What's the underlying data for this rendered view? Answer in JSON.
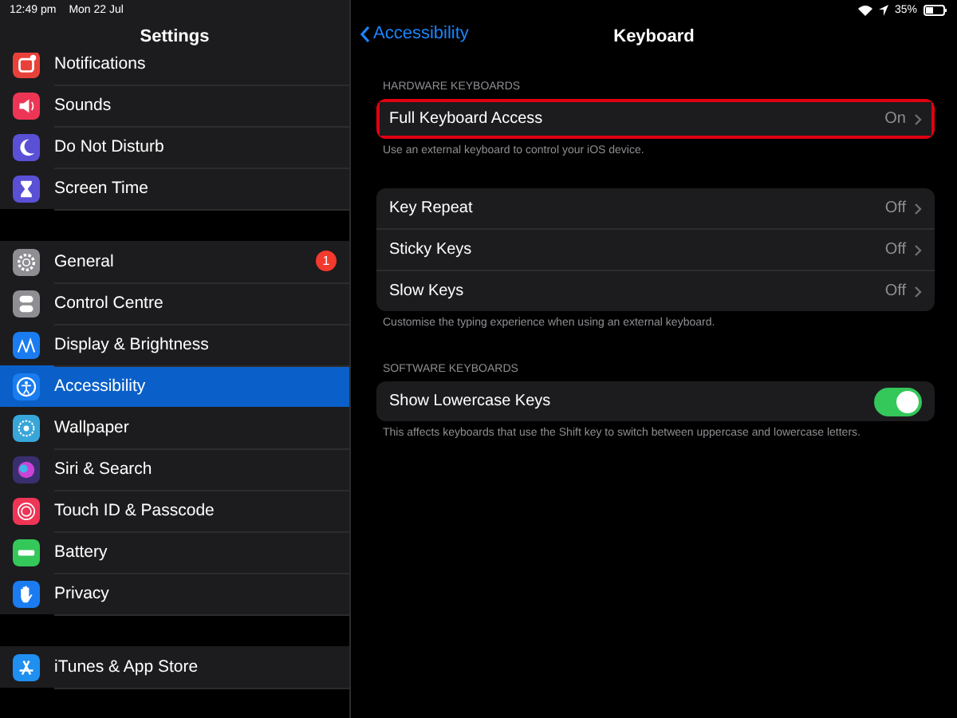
{
  "status_bar": {
    "time": "12:49 pm",
    "date": "Mon 22 Jul",
    "battery": "35%"
  },
  "sidebar": {
    "title": "Settings",
    "groups": [
      [
        {
          "label": "Notifications",
          "color": "#e8413a",
          "selected": false
        },
        {
          "label": "Sounds",
          "color": "#ee3556",
          "selected": false
        },
        {
          "label": "Do Not Disturb",
          "color": "#5a50d6",
          "selected": false
        },
        {
          "label": "Screen Time",
          "color": "#5a50d6",
          "selected": false
        }
      ],
      [
        {
          "label": "General",
          "color": "#8e8e93",
          "selected": false,
          "badge": "1"
        },
        {
          "label": "Control Centre",
          "color": "#8e8e93",
          "selected": false
        },
        {
          "label": "Display & Brightness",
          "color": "#1a7cf0",
          "selected": false
        },
        {
          "label": "Accessibility",
          "color": "#1a7cf0",
          "selected": true
        },
        {
          "label": "Wallpaper",
          "color": "#38a6d8",
          "selected": false
        },
        {
          "label": "Siri & Search",
          "color": "#3a2f6e",
          "selected": false
        },
        {
          "label": "Touch ID & Passcode",
          "color": "#ee3556",
          "selected": false
        },
        {
          "label": "Battery",
          "color": "#34c759",
          "selected": false
        },
        {
          "label": "Privacy",
          "color": "#1a7cf0",
          "selected": false
        }
      ],
      [
        {
          "label": "iTunes & App Store",
          "color": "#1f8ff0",
          "selected": false
        }
      ]
    ]
  },
  "detail": {
    "back": "Accessibility",
    "title": "Keyboard",
    "sections": [
      {
        "header": "HARDWARE KEYBOARDS",
        "rows": [
          {
            "kind": "link",
            "label": "Full Keyboard Access",
            "value": "On",
            "outlined": true
          }
        ],
        "footer": "Use an external keyboard to control your iOS device."
      },
      {
        "rows": [
          {
            "kind": "link",
            "label": "Key Repeat",
            "value": "Off",
            "outlined": false
          },
          {
            "kind": "link",
            "label": "Sticky Keys",
            "value": "Off",
            "outlined": false
          },
          {
            "kind": "link",
            "label": "Slow Keys",
            "value": "Off",
            "outlined": false
          }
        ],
        "footer": "Customise the typing experience when using an external keyboard."
      },
      {
        "header": "SOFTWARE KEYBOARDS",
        "rows": [
          {
            "kind": "toggle",
            "label": "Show Lowercase Keys",
            "on": true,
            "outlined": false
          }
        ],
        "footer": "This affects keyboards that use the Shift key to switch between uppercase and lowercase letters."
      }
    ]
  }
}
